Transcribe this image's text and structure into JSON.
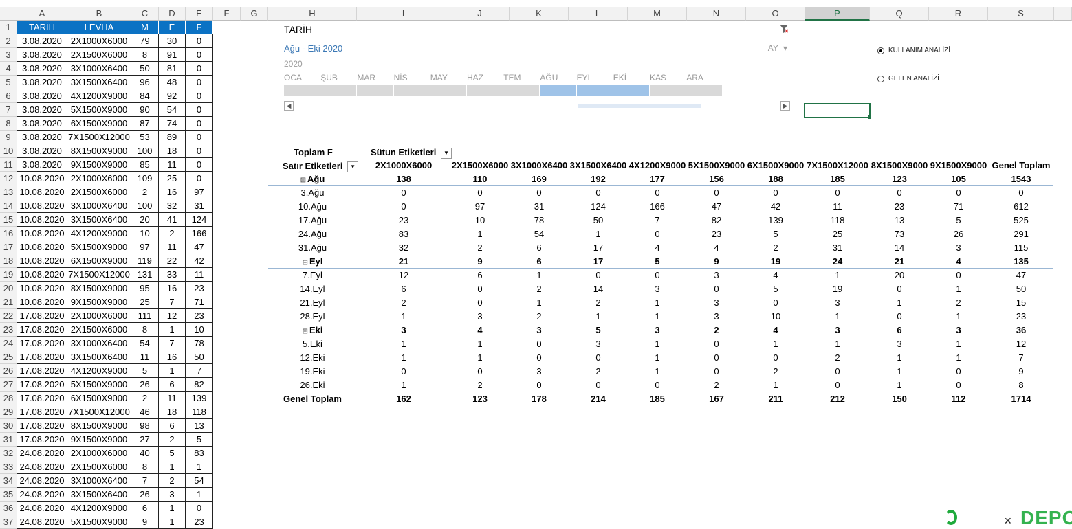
{
  "columns": [
    "A",
    "B",
    "C",
    "D",
    "E",
    "F",
    "G",
    "H",
    "I",
    "J",
    "K",
    "L",
    "M",
    "N",
    "O",
    "P",
    "Q",
    "R",
    "S"
  ],
  "selected_column": "P",
  "row_numbers": [
    1,
    2,
    3,
    4,
    5,
    6,
    7,
    8,
    9,
    10,
    11,
    12,
    13,
    14,
    15,
    16,
    17,
    18,
    19,
    20,
    21,
    22,
    23,
    24,
    25,
    26,
    27,
    28,
    29,
    30,
    31,
    32,
    33,
    34,
    35,
    36,
    37
  ],
  "data_table": {
    "headers": [
      "TARİH",
      "LEVHA",
      "M",
      "E",
      "F"
    ],
    "rows": [
      [
        "3.08.2020",
        "2X1000X6000",
        "79",
        "30",
        "0"
      ],
      [
        "3.08.2020",
        "2X1500X6000",
        "8",
        "91",
        "0"
      ],
      [
        "3.08.2020",
        "3X1000X6400",
        "50",
        "81",
        "0"
      ],
      [
        "3.08.2020",
        "3X1500X6400",
        "96",
        "48",
        "0"
      ],
      [
        "3.08.2020",
        "4X1200X9000",
        "84",
        "92",
        "0"
      ],
      [
        "3.08.2020",
        "5X1500X9000",
        "90",
        "54",
        "0"
      ],
      [
        "3.08.2020",
        "6X1500X9000",
        "87",
        "74",
        "0"
      ],
      [
        "3.08.2020",
        "7X1500X12000",
        "53",
        "89",
        "0"
      ],
      [
        "3.08.2020",
        "8X1500X9000",
        "100",
        "18",
        "0"
      ],
      [
        "3.08.2020",
        "9X1500X9000",
        "85",
        "11",
        "0"
      ],
      [
        "10.08.2020",
        "2X1000X6000",
        "109",
        "25",
        "0"
      ],
      [
        "10.08.2020",
        "2X1500X6000",
        "2",
        "16",
        "97"
      ],
      [
        "10.08.2020",
        "3X1000X6400",
        "100",
        "32",
        "31"
      ],
      [
        "10.08.2020",
        "3X1500X6400",
        "20",
        "41",
        "124"
      ],
      [
        "10.08.2020",
        "4X1200X9000",
        "10",
        "2",
        "166"
      ],
      [
        "10.08.2020",
        "5X1500X9000",
        "97",
        "11",
        "47"
      ],
      [
        "10.08.2020",
        "6X1500X9000",
        "119",
        "22",
        "42"
      ],
      [
        "10.08.2020",
        "7X1500X12000",
        "131",
        "33",
        "11"
      ],
      [
        "10.08.2020",
        "8X1500X9000",
        "95",
        "16",
        "23"
      ],
      [
        "10.08.2020",
        "9X1500X9000",
        "25",
        "7",
        "71"
      ],
      [
        "17.08.2020",
        "2X1000X6000",
        "111",
        "12",
        "23"
      ],
      [
        "17.08.2020",
        "2X1500X6000",
        "8",
        "1",
        "10"
      ],
      [
        "17.08.2020",
        "3X1000X6400",
        "54",
        "7",
        "78"
      ],
      [
        "17.08.2020",
        "3X1500X6400",
        "11",
        "16",
        "50"
      ],
      [
        "17.08.2020",
        "4X1200X9000",
        "5",
        "1",
        "7"
      ],
      [
        "17.08.2020",
        "5X1500X9000",
        "26",
        "6",
        "82"
      ],
      [
        "17.08.2020",
        "6X1500X9000",
        "2",
        "11",
        "139"
      ],
      [
        "17.08.2020",
        "7X1500X12000",
        "46",
        "18",
        "118"
      ],
      [
        "17.08.2020",
        "8X1500X9000",
        "98",
        "6",
        "13"
      ],
      [
        "17.08.2020",
        "9X1500X9000",
        "27",
        "2",
        "5"
      ],
      [
        "24.08.2020",
        "2X1000X6000",
        "40",
        "5",
        "83"
      ],
      [
        "24.08.2020",
        "2X1500X6000",
        "8",
        "1",
        "1"
      ],
      [
        "24.08.2020",
        "3X1000X6400",
        "7",
        "2",
        "54"
      ],
      [
        "24.08.2020",
        "3X1500X6400",
        "26",
        "3",
        "1"
      ],
      [
        "24.08.2020",
        "4X1200X9000",
        "6",
        "1",
        "0"
      ],
      [
        "24.08.2020",
        "5X1500X9000",
        "9",
        "1",
        "23"
      ]
    ]
  },
  "slicer": {
    "title": "TARİH",
    "range": "Ağu - Eki 2020",
    "level": "AY",
    "year": "2020",
    "months": [
      "OCA",
      "ŞUB",
      "MAR",
      "NİS",
      "MAY",
      "HAZ",
      "TEM",
      "AĞU",
      "EYL",
      "EKİ",
      "KAS",
      "ARA"
    ],
    "selected_months": [
      "AĞU",
      "EYL",
      "EKİ"
    ]
  },
  "options": {
    "option1": "KULLANIM ANALİZİ",
    "option2": "GELEN ANALİZİ",
    "selected": "KULLANIM ANALİZİ"
  },
  "pivot": {
    "value_label": "Toplam F",
    "col_labels": "Sütun Etiketleri",
    "row_labels": "Satır Etiketleri",
    "columns": [
      "2X1000X6000",
      "2X1500X6000",
      "3X1000X6400",
      "3X1500X6400",
      "4X1200X9000",
      "5X1500X9000",
      "6X1500X9000",
      "7X1500X12000",
      "8X1500X9000",
      "9X1500X9000",
      "Genel Toplam"
    ],
    "rows": [
      {
        "label": "Ağu",
        "group": true,
        "values": [
          "138",
          "110",
          "169",
          "192",
          "177",
          "156",
          "188",
          "185",
          "123",
          "105",
          "1543"
        ]
      },
      {
        "label": "3.Ağu",
        "group": false,
        "values": [
          "0",
          "0",
          "0",
          "0",
          "0",
          "0",
          "0",
          "0",
          "0",
          "0",
          "0"
        ]
      },
      {
        "label": "10.Ağu",
        "group": false,
        "values": [
          "0",
          "97",
          "31",
          "124",
          "166",
          "47",
          "42",
          "11",
          "23",
          "71",
          "612"
        ]
      },
      {
        "label": "17.Ağu",
        "group": false,
        "values": [
          "23",
          "10",
          "78",
          "50",
          "7",
          "82",
          "139",
          "118",
          "13",
          "5",
          "525"
        ]
      },
      {
        "label": "24.Ağu",
        "group": false,
        "values": [
          "83",
          "1",
          "54",
          "1",
          "0",
          "23",
          "5",
          "25",
          "73",
          "26",
          "291"
        ]
      },
      {
        "label": "31.Ağu",
        "group": false,
        "values": [
          "32",
          "2",
          "6",
          "17",
          "4",
          "4",
          "2",
          "31",
          "14",
          "3",
          "115"
        ]
      },
      {
        "label": "Eyl",
        "group": true,
        "values": [
          "21",
          "9",
          "6",
          "17",
          "5",
          "9",
          "19",
          "24",
          "21",
          "4",
          "135"
        ]
      },
      {
        "label": "7.Eyl",
        "group": false,
        "values": [
          "12",
          "6",
          "1",
          "0",
          "0",
          "3",
          "4",
          "1",
          "20",
          "0",
          "47"
        ]
      },
      {
        "label": "14.Eyl",
        "group": false,
        "values": [
          "6",
          "0",
          "2",
          "14",
          "3",
          "0",
          "5",
          "19",
          "0",
          "1",
          "50"
        ]
      },
      {
        "label": "21.Eyl",
        "group": false,
        "values": [
          "2",
          "0",
          "1",
          "2",
          "1",
          "3",
          "0",
          "3",
          "1",
          "2",
          "15"
        ]
      },
      {
        "label": "28.Eyl",
        "group": false,
        "values": [
          "1",
          "3",
          "2",
          "1",
          "1",
          "3",
          "10",
          "1",
          "0",
          "1",
          "23"
        ]
      },
      {
        "label": "Eki",
        "group": true,
        "values": [
          "3",
          "4",
          "3",
          "5",
          "3",
          "2",
          "4",
          "3",
          "6",
          "3",
          "36"
        ]
      },
      {
        "label": "5.Eki",
        "group": false,
        "values": [
          "1",
          "1",
          "0",
          "3",
          "1",
          "0",
          "1",
          "1",
          "3",
          "1",
          "12"
        ]
      },
      {
        "label": "12.Eki",
        "group": false,
        "values": [
          "1",
          "1",
          "0",
          "0",
          "1",
          "0",
          "0",
          "2",
          "1",
          "1",
          "7"
        ]
      },
      {
        "label": "19.Eki",
        "group": false,
        "values": [
          "0",
          "0",
          "3",
          "2",
          "1",
          "0",
          "2",
          "0",
          "1",
          "0",
          "9"
        ]
      },
      {
        "label": "26.Eki",
        "group": false,
        "values": [
          "1",
          "2",
          "0",
          "0",
          "0",
          "2",
          "1",
          "0",
          "1",
          "0",
          "8"
        ]
      }
    ],
    "grand_total_label": "Genel Toplam",
    "grand_total": [
      "162",
      "123",
      "178",
      "214",
      "185",
      "167",
      "211",
      "212",
      "150",
      "112",
      "1714"
    ]
  },
  "watermark": "DEPO",
  "colors": {
    "header_blue": "#0b72c4",
    "accent_green": "#217346",
    "slicer_selected": "#9fc3e8"
  }
}
